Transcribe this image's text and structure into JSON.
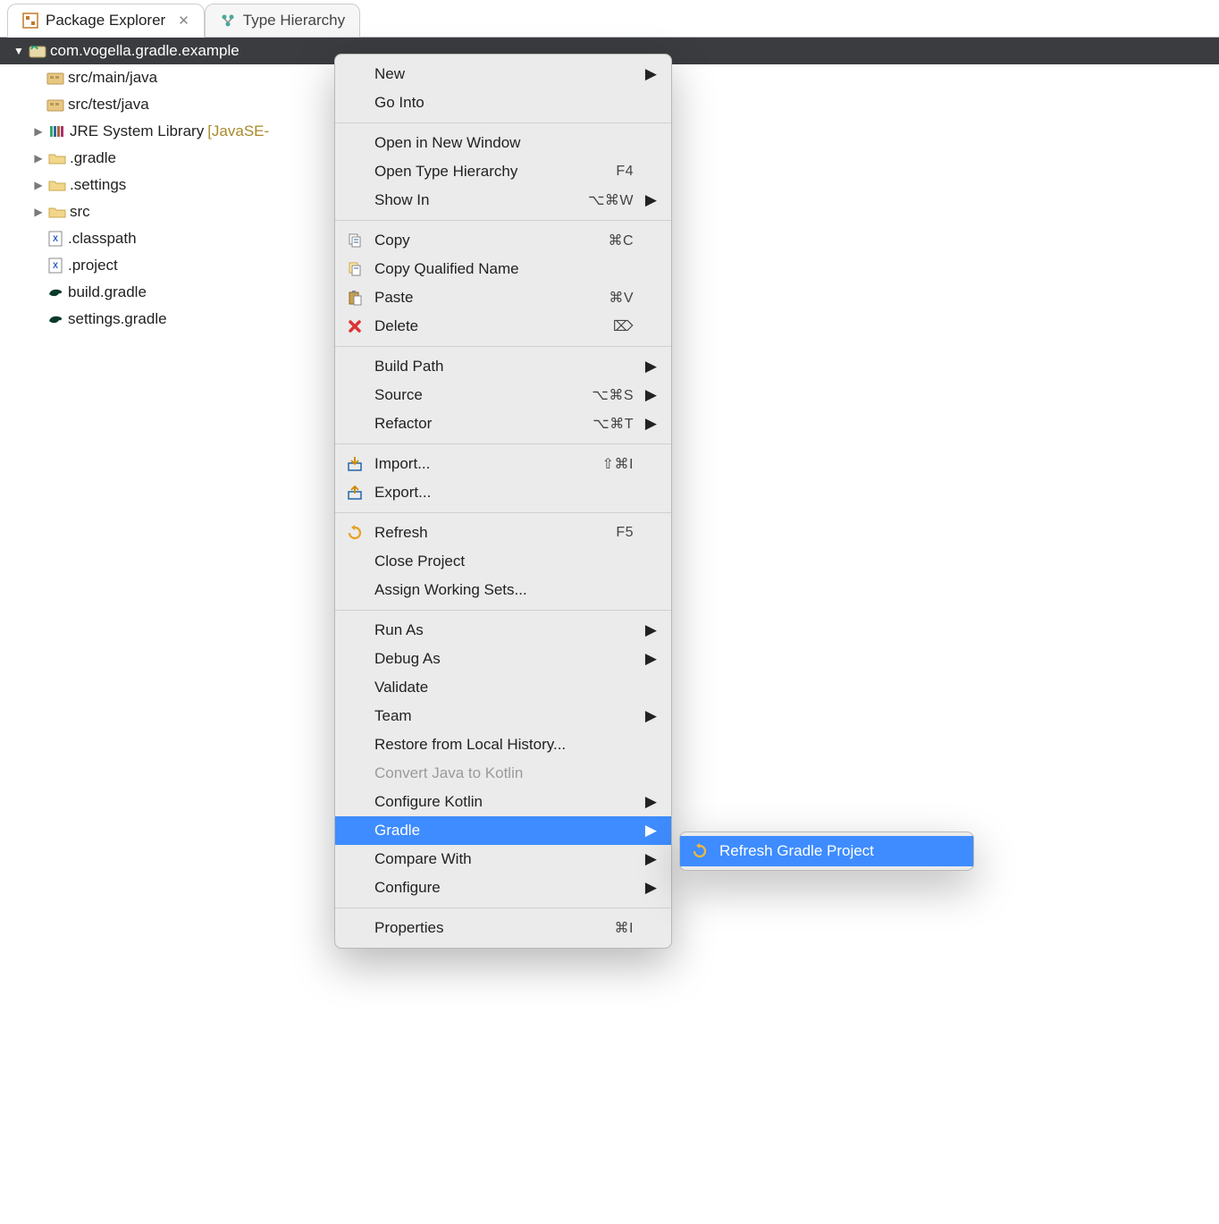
{
  "tabs": [
    {
      "label": "Package Explorer",
      "active": true
    },
    {
      "label": "Type Hierarchy",
      "active": false
    }
  ],
  "tree": {
    "project": "com.vogella.gradle.example",
    "children": [
      {
        "label": "src/main/java",
        "icon": "package",
        "indent": 34,
        "arrow": ""
      },
      {
        "label": "src/test/java",
        "icon": "package",
        "indent": 34,
        "arrow": ""
      },
      {
        "label": "JRE System Library",
        "suffix": " [JavaSE-",
        "icon": "library",
        "indent": 18,
        "arrow": "▶"
      },
      {
        "label": ".gradle",
        "icon": "folder",
        "indent": 18,
        "arrow": "▶"
      },
      {
        "label": ".settings",
        "icon": "folder",
        "indent": 18,
        "arrow": "▶"
      },
      {
        "label": "src",
        "icon": "folder",
        "indent": 18,
        "arrow": "▶"
      },
      {
        "label": ".classpath",
        "icon": "xmlfile",
        "indent": 34,
        "arrow": ""
      },
      {
        "label": ".project",
        "icon": "xmlfile",
        "indent": 34,
        "arrow": ""
      },
      {
        "label": "build.gradle",
        "icon": "gradle",
        "indent": 34,
        "arrow": ""
      },
      {
        "label": "settings.gradle",
        "icon": "gradle",
        "indent": 34,
        "arrow": ""
      }
    ]
  },
  "context_menu": [
    [
      {
        "label": "New",
        "submenu": true
      },
      {
        "label": "Go Into"
      }
    ],
    [
      {
        "label": "Open in New Window"
      },
      {
        "label": "Open Type Hierarchy",
        "shortcut": "F4"
      },
      {
        "label": "Show In",
        "shortcut": "⌥⌘W",
        "submenu": true
      }
    ],
    [
      {
        "label": "Copy",
        "icon": "copy",
        "shortcut": "⌘C"
      },
      {
        "label": "Copy Qualified Name",
        "icon": "copyq"
      },
      {
        "label": "Paste",
        "icon": "paste",
        "shortcut": "⌘V"
      },
      {
        "label": "Delete",
        "icon": "delete",
        "shortcut": "⌦"
      }
    ],
    [
      {
        "label": "Build Path",
        "submenu": true
      },
      {
        "label": "Source",
        "shortcut": "⌥⌘S",
        "submenu": true
      },
      {
        "label": "Refactor",
        "shortcut": "⌥⌘T",
        "submenu": true
      }
    ],
    [
      {
        "label": "Import...",
        "icon": "import",
        "shortcut": "⇧⌘I"
      },
      {
        "label": "Export...",
        "icon": "export"
      }
    ],
    [
      {
        "label": "Refresh",
        "icon": "refresh",
        "shortcut": "F5"
      },
      {
        "label": "Close Project"
      },
      {
        "label": "Assign Working Sets..."
      }
    ],
    [
      {
        "label": "Run As",
        "submenu": true
      },
      {
        "label": "Debug As",
        "submenu": true
      },
      {
        "label": "Validate"
      },
      {
        "label": "Team",
        "submenu": true
      },
      {
        "label": "Restore from Local History..."
      },
      {
        "label": "Convert Java to Kotlin",
        "disabled": true
      },
      {
        "label": "Configure Kotlin",
        "submenu": true
      },
      {
        "label": "Gradle",
        "submenu": true,
        "highlight": true
      },
      {
        "label": "Compare With",
        "submenu": true
      },
      {
        "label": "Configure",
        "submenu": true
      }
    ],
    [
      {
        "label": "Properties",
        "shortcut": "⌘I"
      }
    ]
  ],
  "submenu": {
    "item": {
      "label": "Refresh Gradle Project",
      "icon": "refresh",
      "highlight": true
    }
  }
}
